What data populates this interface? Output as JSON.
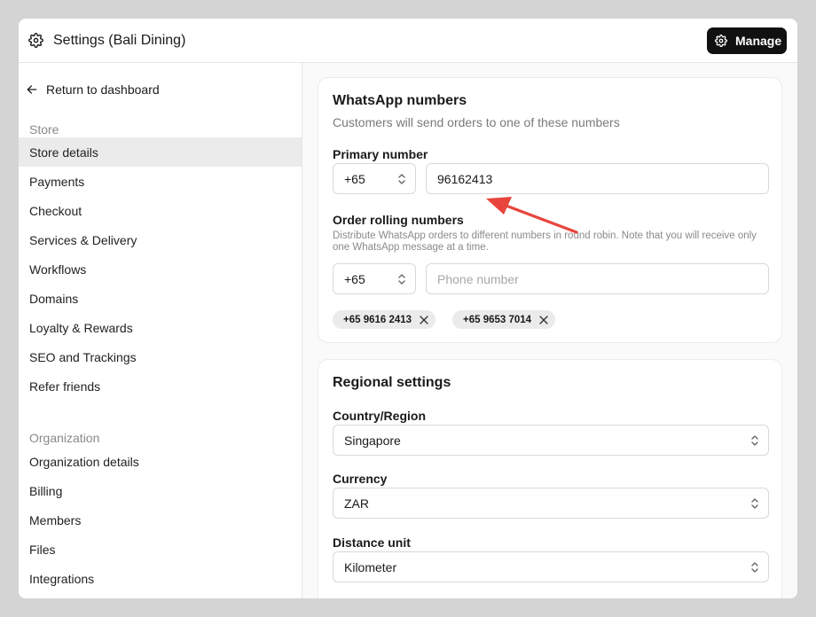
{
  "header": {
    "title": "Settings (Bali Dining)",
    "manage_label": "Manage"
  },
  "sidebar": {
    "back_label": "Return to dashboard",
    "store_label": "Store",
    "store_items": [
      {
        "label": "Store details",
        "active": true
      },
      {
        "label": "Payments"
      },
      {
        "label": "Checkout"
      },
      {
        "label": "Services & Delivery"
      },
      {
        "label": "Workflows"
      },
      {
        "label": "Domains"
      },
      {
        "label": "Loyalty & Rewards"
      },
      {
        "label": "SEO and Trackings"
      },
      {
        "label": "Refer friends"
      }
    ],
    "org_label": "Organization",
    "org_items": [
      {
        "label": "Organization details"
      },
      {
        "label": "Billing"
      },
      {
        "label": "Members"
      },
      {
        "label": "Files"
      },
      {
        "label": "Integrations"
      }
    ]
  },
  "whatsapp": {
    "title": "WhatsApp numbers",
    "subtitle": "Customers will send orders to one of these numbers",
    "primary_label": "Primary number",
    "primary_code": "+65",
    "primary_value": "96162413",
    "rolling_label": "Order rolling numbers",
    "rolling_help": "Distribute WhatsApp orders to different numbers in round robin. Note that you will receive only one WhatsApp message at a time.",
    "rolling_code": "+65",
    "rolling_placeholder": "Phone number",
    "chips": [
      "+65 9616 2413",
      "+65 9653 7014"
    ]
  },
  "regional": {
    "title": "Regional settings",
    "country_label": "Country/Region",
    "country_value": "Singapore",
    "currency_label": "Currency",
    "currency_value": "ZAR",
    "distance_label": "Distance unit",
    "distance_value": "Kilometer"
  },
  "colors": {
    "accent_arrow": "#e8453c",
    "button_dark": "#111111"
  }
}
